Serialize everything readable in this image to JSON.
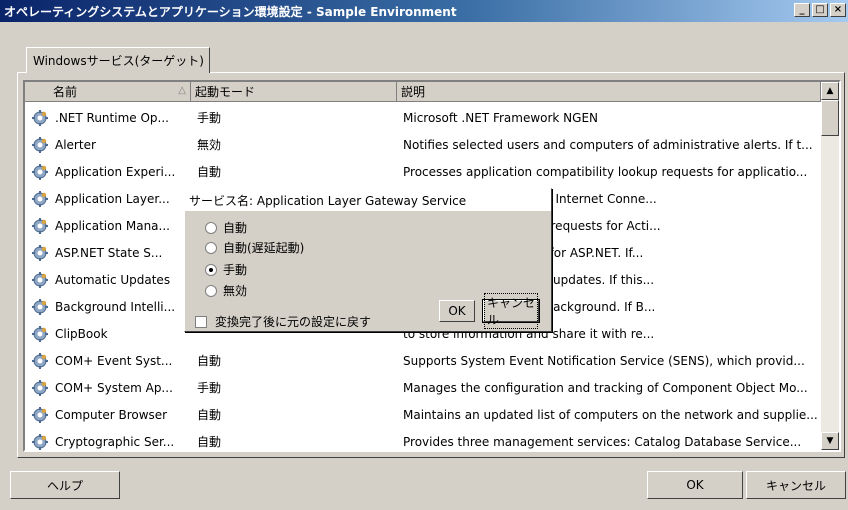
{
  "window": {
    "title": "オペレーティングシステムとアプリケーション環境設定 - Sample Environment",
    "minimize": "_",
    "maximize": "□",
    "close": "×"
  },
  "tab": {
    "label": "Windowsサービス(ターゲット)"
  },
  "table": {
    "columns": [
      "名前",
      "起動モード",
      "説明"
    ],
    "sort_indicator": "△",
    "rows": [
      {
        "name": ".NET Runtime Op...",
        "mode": "手動",
        "desc": "Microsoft .NET Framework NGEN"
      },
      {
        "name": "Alerter",
        "mode": "無効",
        "desc": "Notifies selected users and computers of administrative alerts. If t..."
      },
      {
        "name": "Application Experi...",
        "mode": "自動",
        "desc": "Processes application compatibility lookup requests for applicatio..."
      },
      {
        "name": "Application Layer...",
        "mode": "",
        "desc": "arty protocol plug-ins for Internet Conne..."
      },
      {
        "name": "Application Mana...",
        "mode": "",
        "desc": "noval, and enumeration requests for Acti..."
      },
      {
        "name": "ASP.NET State S...",
        "mode": "",
        "desc": "f-process session states for ASP.NET. If..."
      },
      {
        "name": "Automatic Updates",
        "mode": "",
        "desc": "l installation of Windows updates. If this..."
      },
      {
        "name": "Background Intelli...",
        "mode": "",
        "desc": "ents and servers in the background. If B..."
      },
      {
        "name": "ClipBook",
        "mode": "",
        "desc": "to store information and share it with re..."
      },
      {
        "name": "COM+ Event Syst...",
        "mode": "自動",
        "desc": "Supports System Event Notification Service (SENS), which provid..."
      },
      {
        "name": "COM+ System Ap...",
        "mode": "手動",
        "desc": "Manages the configuration and tracking of Component Object Mo..."
      },
      {
        "name": "Computer Browser",
        "mode": "自動",
        "desc": "Maintains an updated list of computers on the network and supplie..."
      },
      {
        "name": "Cryptographic Ser...",
        "mode": "自動",
        "desc": "Provides three management services: Catalog Database Service..."
      }
    ]
  },
  "popup": {
    "title": "サービス名: Application Layer Gateway Service",
    "options": [
      {
        "label": "自動",
        "checked": false
      },
      {
        "label": "自動(遅延起動)",
        "checked": false
      },
      {
        "label": "手動",
        "checked": true
      },
      {
        "label": "無効",
        "checked": false
      }
    ],
    "restore_label": "変換完了後に元の設定に戻す",
    "ok": "OK",
    "cancel": "キャンセル"
  },
  "footer": {
    "help": "ヘルプ",
    "ok": "OK",
    "cancel": "キャンセル"
  },
  "icons": {
    "row_icon": "service-gear-icon",
    "scroll_up": "scroll-up-arrow-icon",
    "scroll_down": "scroll-down-arrow-icon"
  }
}
